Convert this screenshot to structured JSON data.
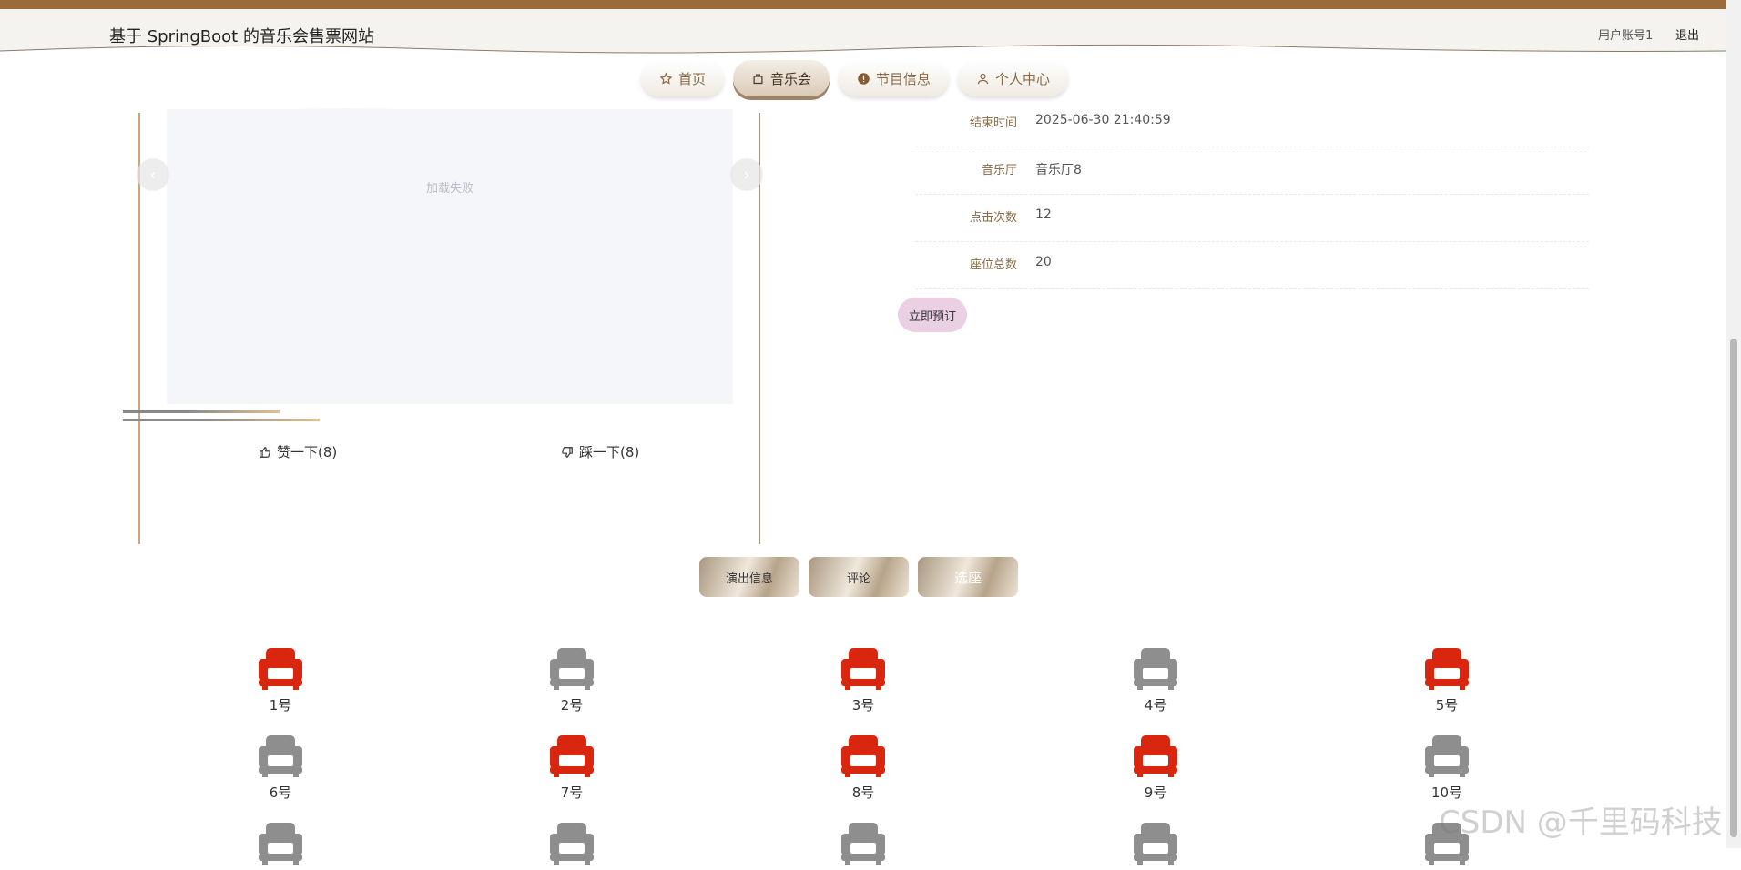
{
  "header": {
    "site_title": "基于 SpringBoot 的音乐会售票网站",
    "account": "用户账号1",
    "logout": "退出"
  },
  "nav": [
    {
      "label": "首页",
      "icon": "star-icon"
    },
    {
      "label": "音乐会",
      "icon": "bag-icon",
      "active": true
    },
    {
      "label": "节目信息",
      "icon": "info-icon"
    },
    {
      "label": "个人中心",
      "icon": "user-icon"
    }
  ],
  "carousel": {
    "slide_text": "加载失败",
    "prev_symbol": "‹",
    "next_symbol": "›"
  },
  "reactions": {
    "like_label": "赞一下(8)",
    "dislike_label": "踩一下(8)"
  },
  "info": [
    {
      "label": "结束时间",
      "value": "2025-06-30 21:40:59"
    },
    {
      "label": "音乐厅",
      "value": "音乐厅8"
    },
    {
      "label": "点击次数",
      "value": "12"
    },
    {
      "label": "座位总数",
      "value": "20"
    }
  ],
  "book_button": "立即预订",
  "tabs": [
    {
      "label": "演出信息"
    },
    {
      "label": "评论"
    },
    {
      "label": "选座",
      "active": true
    }
  ],
  "seats": [
    {
      "label": "1号",
      "status": "booked"
    },
    {
      "label": "2号",
      "status": "available"
    },
    {
      "label": "3号",
      "status": "booked"
    },
    {
      "label": "4号",
      "status": "available"
    },
    {
      "label": "5号",
      "status": "booked"
    },
    {
      "label": "6号",
      "status": "available"
    },
    {
      "label": "7号",
      "status": "booked"
    },
    {
      "label": "8号",
      "status": "booked"
    },
    {
      "label": "9号",
      "status": "booked"
    },
    {
      "label": "10号",
      "status": "available"
    },
    {
      "label": "",
      "status": "available"
    },
    {
      "label": "",
      "status": "available"
    },
    {
      "label": "",
      "status": "available"
    },
    {
      "label": "",
      "status": "available"
    },
    {
      "label": "",
      "status": "available"
    }
  ],
  "colors": {
    "booked": "#d9260f",
    "available": "#8e8e8e",
    "accent": "#9b6b3a"
  },
  "watermark": "CSDN @千里码科技"
}
